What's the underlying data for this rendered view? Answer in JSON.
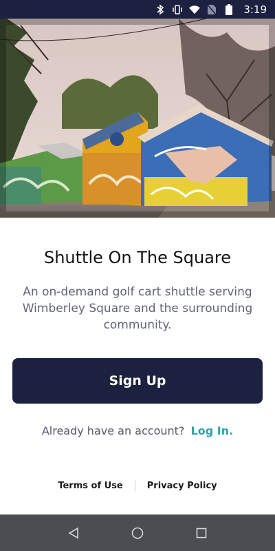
{
  "status_bar": {
    "time": "3:19",
    "icons": [
      "bluetooth-icon",
      "vibrate-icon",
      "wifi-icon",
      "no-sim-icon",
      "battery-icon"
    ]
  },
  "hero": {
    "subject": "painted-shed-mural-photo"
  },
  "main": {
    "title": "Shuttle On The Square",
    "description": "An on-demand golf cart shuttle serving Wimberley Square and the surrounding community.",
    "signup_label": "Sign Up",
    "login_prompt": "Already have an account?",
    "login_link": "Log In."
  },
  "footer": {
    "terms_label": "Terms of Use",
    "privacy_label": "Privacy Policy"
  },
  "nav_bar": {
    "icons": [
      "back-icon",
      "home-icon",
      "recents-icon"
    ]
  },
  "colors": {
    "primary": "#1c2140",
    "accent": "#2aa6a9",
    "text_muted": "#616478",
    "nav_bar": "#4a4d52"
  }
}
